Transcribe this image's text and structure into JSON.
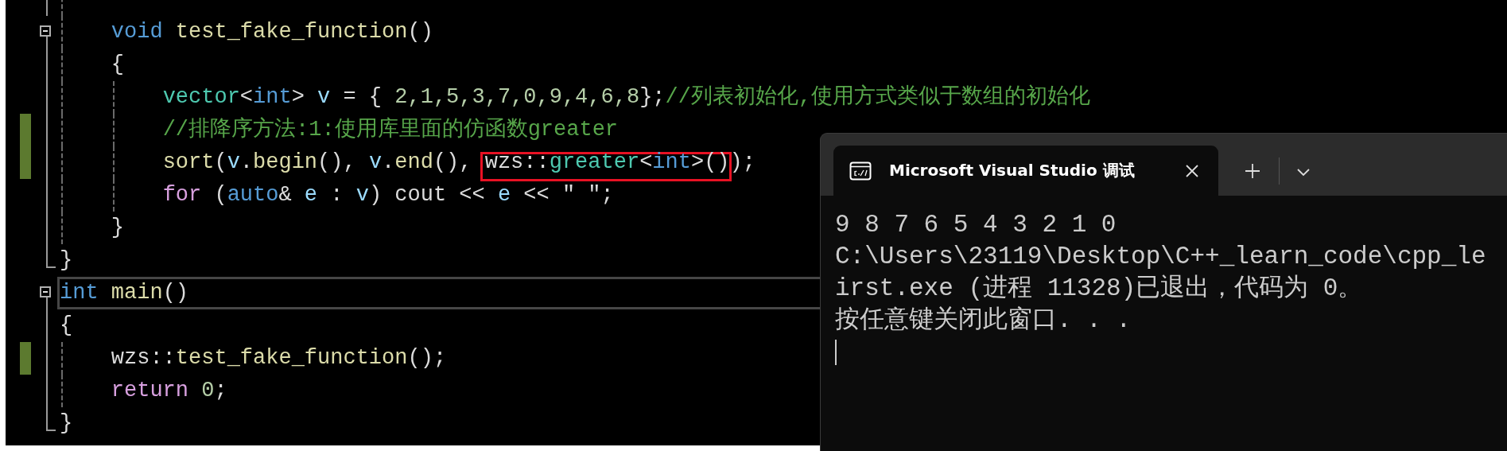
{
  "editor": {
    "lines": [
      {
        "kind": "body",
        "changed": false,
        "current": false
      },
      {
        "kind": "start",
        "changed": false,
        "current": false,
        "tokens": [
          {
            "text": "    void ",
            "kind": "keyword"
          },
          {
            "text": "test_fake_function",
            "kind": "function"
          },
          {
            "text": "()",
            "kind": "plain"
          }
        ]
      },
      {
        "kind": "body",
        "changed": false,
        "current": false,
        "tokens": [
          {
            "text": "    {",
            "kind": "plain"
          }
        ]
      },
      {
        "kind": "body",
        "changed": false,
        "current": false,
        "tokens": [
          {
            "text": "        vector",
            "kind": "type"
          },
          {
            "text": "<",
            "kind": "plain"
          },
          {
            "text": "int",
            "kind": "keyword"
          },
          {
            "text": "> ",
            "kind": "plain"
          },
          {
            "text": "v",
            "kind": "variable"
          },
          {
            "text": " = { ",
            "kind": "plain"
          },
          {
            "text": "2,1,5,3,7,0,9,4,6,8",
            "kind": "number"
          },
          {
            "text": "};",
            "kind": "plain"
          },
          {
            "text": "//列表初始化,使用方式类似于数组的初始化",
            "kind": "comment"
          }
        ]
      },
      {
        "kind": "body",
        "changed": true,
        "current": false,
        "tokens": [
          {
            "text": "        //排降序方法:1:使用库里面的仿函数greater",
            "kind": "comment"
          }
        ]
      },
      {
        "kind": "body",
        "changed": true,
        "current": false,
        "tokens": [
          {
            "text": "        sort",
            "kind": "function"
          },
          {
            "text": "(",
            "kind": "plain"
          },
          {
            "text": "v",
            "kind": "variable"
          },
          {
            "text": ".",
            "kind": "plain"
          },
          {
            "text": "begin",
            "kind": "function"
          },
          {
            "text": "(), ",
            "kind": "plain"
          },
          {
            "text": "v",
            "kind": "variable"
          },
          {
            "text": ".",
            "kind": "plain"
          },
          {
            "text": "end",
            "kind": "function"
          },
          {
            "text": "(), ",
            "kind": "plain"
          },
          {
            "text": "wzs::",
            "kind": "plain",
            "boxed": true
          },
          {
            "text": "greater",
            "kind": "type",
            "boxed": true
          },
          {
            "text": "<",
            "kind": "plain",
            "boxed": true
          },
          {
            "text": "int",
            "kind": "keyword",
            "boxed": true
          },
          {
            "text": ">()",
            "kind": "plain",
            "boxed": true
          },
          {
            "text": ");",
            "kind": "plain"
          }
        ]
      },
      {
        "kind": "body",
        "changed": false,
        "current": false,
        "tokens": [
          {
            "text": "        for",
            "kind": "control"
          },
          {
            "text": " (",
            "kind": "plain"
          },
          {
            "text": "auto",
            "kind": "keyword"
          },
          {
            "text": "& ",
            "kind": "plain"
          },
          {
            "text": "e",
            "kind": "variable"
          },
          {
            "text": " : ",
            "kind": "plain"
          },
          {
            "text": "v",
            "kind": "variable"
          },
          {
            "text": ") cout << ",
            "kind": "plain"
          },
          {
            "text": "e",
            "kind": "variable"
          },
          {
            "text": " << \" \";",
            "kind": "plain"
          }
        ]
      },
      {
        "kind": "body",
        "changed": false,
        "current": false,
        "tokens": [
          {
            "text": "    }",
            "kind": "plain"
          }
        ]
      },
      {
        "kind": "end",
        "changed": false,
        "current": false,
        "tokens": [
          {
            "text": "}",
            "kind": "plain"
          }
        ]
      },
      {
        "kind": "start",
        "changed": false,
        "current": true,
        "tokens": [
          {
            "text": "int ",
            "kind": "keyword"
          },
          {
            "text": "main",
            "kind": "function"
          },
          {
            "text": "()",
            "kind": "plain"
          }
        ]
      },
      {
        "kind": "body",
        "changed": false,
        "current": false,
        "tokens": [
          {
            "text": "{",
            "kind": "plain"
          }
        ]
      },
      {
        "kind": "body",
        "changed": true,
        "current": false,
        "tokens": [
          {
            "text": "    wzs::",
            "kind": "plain"
          },
          {
            "text": "test_fake_function",
            "kind": "function"
          },
          {
            "text": "();",
            "kind": "plain"
          }
        ]
      },
      {
        "kind": "body",
        "changed": false,
        "current": false,
        "tokens": [
          {
            "text": "    return ",
            "kind": "control"
          },
          {
            "text": "0",
            "kind": "number"
          },
          {
            "text": ";",
            "kind": "plain"
          }
        ]
      },
      {
        "kind": "end",
        "changed": false,
        "current": false,
        "tokens": [
          {
            "text": "}",
            "kind": "plain"
          }
        ]
      }
    ]
  },
  "console": {
    "tabs": [
      {
        "title": "Microsoft Visual Studio 调试",
        "selected": true
      }
    ],
    "output_lines": [
      "9 8 7 6 5 4 3 2 1 0",
      "C:\\Users\\23119\\Desktop\\C++_learn_code\\cpp_le",
      "irst.exe (进程 11328)已退出，代码为 0。",
      "按任意键关闭此窗口. . ."
    ]
  }
}
